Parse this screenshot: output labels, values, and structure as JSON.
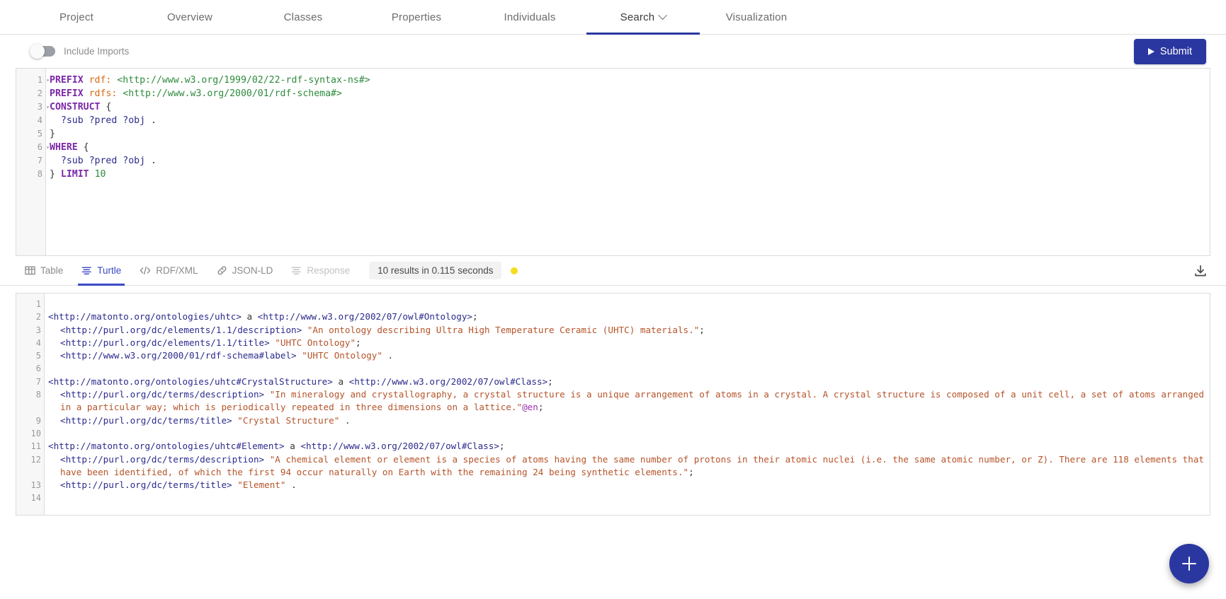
{
  "nav": {
    "tabs": [
      {
        "label": "Project",
        "active": false,
        "chevron": false
      },
      {
        "label": "Overview",
        "active": false,
        "chevron": false
      },
      {
        "label": "Classes",
        "active": false,
        "chevron": false
      },
      {
        "label": "Properties",
        "active": false,
        "chevron": false
      },
      {
        "label": "Individuals",
        "active": false,
        "chevron": false
      },
      {
        "label": "Search",
        "active": true,
        "chevron": true
      },
      {
        "label": "Visualization",
        "active": false,
        "chevron": false
      }
    ]
  },
  "actionbar": {
    "toggle_label": "Include Imports",
    "toggle_on": false,
    "submit_label": "Submit"
  },
  "editor": {
    "line_numbers": [
      "1",
      "2",
      "3",
      "4",
      "5",
      "6",
      "7",
      "8"
    ],
    "fold_lines": [
      1,
      3,
      6
    ],
    "lines": [
      "PREFIX rdf: <http://www.w3.org/1999/02/22-rdf-syntax-ns#>",
      "PREFIX rdfs: <http://www.w3.org/2000/01/rdf-schema#>",
      "CONSTRUCT {",
      "  ?sub ?pred ?obj .",
      "}",
      "WHERE {",
      "  ?sub ?pred ?obj .",
      "} LIMIT 10"
    ]
  },
  "results_tabs": {
    "tabs": [
      {
        "label": "Table",
        "icon": "table-icon",
        "active": false,
        "disabled": false
      },
      {
        "label": "Turtle",
        "icon": "list-icon",
        "active": true,
        "disabled": false
      },
      {
        "label": "RDF/XML",
        "icon": "code-icon",
        "active": false,
        "disabled": false
      },
      {
        "label": "JSON-LD",
        "icon": "link-icon",
        "active": false,
        "disabled": false
      },
      {
        "label": "Response",
        "icon": "list-icon",
        "active": false,
        "disabled": true
      }
    ],
    "status_text": "10 results in 0.115 seconds",
    "status_dot_color": "#f5dd1e",
    "download_label": "download-icon"
  },
  "results": {
    "line_numbers": [
      "1",
      "2",
      "3",
      "4",
      "5",
      "6",
      "7",
      "8",
      "9",
      "10",
      "11",
      "12",
      "13",
      "14"
    ],
    "lines": [
      {
        "n": "1",
        "indent": false,
        "parts": []
      },
      {
        "n": "2",
        "indent": false,
        "parts": [
          {
            "t": "uri",
            "v": "<http://matonto.org/ontologies/uhtc>"
          },
          {
            "t": "plain",
            "v": " a "
          },
          {
            "t": "uri",
            "v": "<http://www.w3.org/2002/07/owl#Ontology>"
          },
          {
            "t": "punc",
            "v": ";"
          }
        ]
      },
      {
        "n": "3",
        "indent": true,
        "parts": [
          {
            "t": "uri",
            "v": "<http://purl.org/dc/elements/1.1/description>"
          },
          {
            "t": "plain",
            "v": " "
          },
          {
            "t": "str",
            "v": "\"An ontology describing Ultra High Temperature Ceramic (UHTC) materials.\""
          },
          {
            "t": "punc",
            "v": ";"
          }
        ]
      },
      {
        "n": "4",
        "indent": true,
        "parts": [
          {
            "t": "uri",
            "v": "<http://purl.org/dc/elements/1.1/title>"
          },
          {
            "t": "plain",
            "v": " "
          },
          {
            "t": "str",
            "v": "\"UHTC Ontology\""
          },
          {
            "t": "punc",
            "v": ";"
          }
        ]
      },
      {
        "n": "5",
        "indent": true,
        "parts": [
          {
            "t": "uri",
            "v": "<http://www.w3.org/2000/01/rdf-schema#label>"
          },
          {
            "t": "plain",
            "v": " "
          },
          {
            "t": "str",
            "v": "\"UHTC Ontology\""
          },
          {
            "t": "punc",
            "v": " ."
          }
        ]
      },
      {
        "n": "6",
        "indent": false,
        "parts": []
      },
      {
        "n": "7",
        "indent": false,
        "parts": [
          {
            "t": "uri",
            "v": "<http://matonto.org/ontologies/uhtc#CrystalStructure>"
          },
          {
            "t": "plain",
            "v": " a "
          },
          {
            "t": "uri",
            "v": "<http://www.w3.org/2002/07/owl#Class>"
          },
          {
            "t": "punc",
            "v": ";"
          }
        ]
      },
      {
        "n": "8",
        "indent": true,
        "parts": [
          {
            "t": "uri",
            "v": "<http://purl.org/dc/terms/description>"
          },
          {
            "t": "plain",
            "v": " "
          },
          {
            "t": "str",
            "v": "\"In mineralogy and crystallography, a crystal structure is a unique arrangement of atoms in a crystal. A crystal structure is composed of a unit cell, a set of atoms arranged in a particular way; which is periodically repeated in three dimensions on a lattice.\""
          },
          {
            "t": "lang",
            "v": "@en"
          },
          {
            "t": "punc",
            "v": ";"
          }
        ]
      },
      {
        "n": "9",
        "indent": true,
        "parts": [
          {
            "t": "uri",
            "v": "<http://purl.org/dc/terms/title>"
          },
          {
            "t": "plain",
            "v": " "
          },
          {
            "t": "str",
            "v": "\"Crystal Structure\""
          },
          {
            "t": "punc",
            "v": " ."
          }
        ]
      },
      {
        "n": "10",
        "indent": false,
        "parts": []
      },
      {
        "n": "11",
        "indent": false,
        "parts": [
          {
            "t": "uri",
            "v": "<http://matonto.org/ontologies/uhtc#Element>"
          },
          {
            "t": "plain",
            "v": " a "
          },
          {
            "t": "uri",
            "v": "<http://www.w3.org/2002/07/owl#Class>"
          },
          {
            "t": "punc",
            "v": ";"
          }
        ]
      },
      {
        "n": "12",
        "indent": true,
        "parts": [
          {
            "t": "uri",
            "v": "<http://purl.org/dc/terms/description>"
          },
          {
            "t": "plain",
            "v": " "
          },
          {
            "t": "str",
            "v": "\"A chemical element or element is a species of atoms having the same number of protons in their atomic nuclei (i.e. the same atomic number, or Z). There are 118 elements that have been identified, of which the first 94 occur naturally on Earth with the remaining 24 being synthetic elements.\""
          },
          {
            "t": "punc",
            "v": ";"
          }
        ]
      },
      {
        "n": "13",
        "indent": true,
        "parts": [
          {
            "t": "uri",
            "v": "<http://purl.org/dc/terms/title>"
          },
          {
            "t": "plain",
            "v": " "
          },
          {
            "t": "str",
            "v": "\"Element\""
          },
          {
            "t": "punc",
            "v": " ."
          }
        ]
      },
      {
        "n": "14",
        "indent": false,
        "parts": []
      }
    ]
  },
  "fab": {
    "label": "+",
    "color": "#2b37a0"
  },
  "colors": {
    "accent": "#2b37a0",
    "tab_active": "#3b49c4",
    "status_dot": "#f5dd1e"
  }
}
